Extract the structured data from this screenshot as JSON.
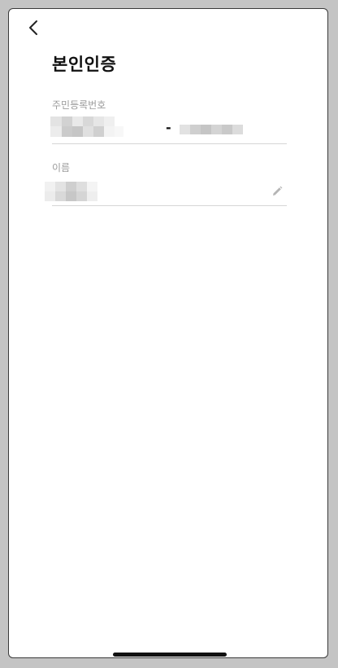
{
  "header": {
    "back_icon": "chevron-left-icon",
    "title": "본인인증"
  },
  "form": {
    "ssn": {
      "label": "주민등록번호",
      "separator": "-"
    },
    "name": {
      "label": "이름",
      "edit_icon": "pencil-icon"
    }
  },
  "colors": {
    "background": "#ffffff",
    "title": "#111111",
    "label": "#9b9b9b",
    "underline": "#d6d6d6"
  }
}
